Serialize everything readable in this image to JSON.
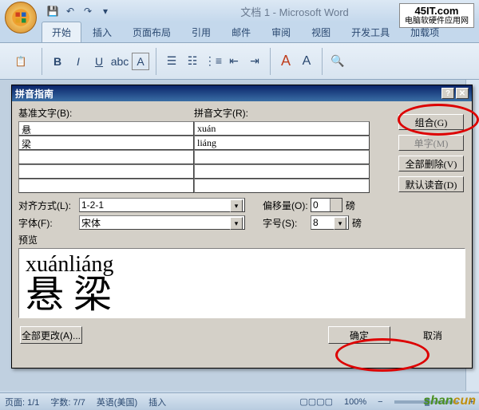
{
  "title": "文档 1 - Microsoft Word",
  "site_logo": {
    "main": "45IT.com",
    "sub": "电脑软硬件应用网"
  },
  "ribbon_tabs": [
    "开始",
    "插入",
    "页面布局",
    "引用",
    "邮件",
    "审阅",
    "视图",
    "开发工具",
    "加载项"
  ],
  "dialog": {
    "title": "拼音指南",
    "base_label": "基准文字(B):",
    "pinyin_label": "拼音文字(R):",
    "rows": [
      {
        "base": "悬",
        "pinyin": "xuán"
      },
      {
        "base": "梁",
        "pinyin": "liáng"
      },
      {
        "base": "",
        "pinyin": ""
      },
      {
        "base": "",
        "pinyin": ""
      },
      {
        "base": "",
        "pinyin": ""
      }
    ],
    "buttons": {
      "combine": "组合(G)",
      "single": "单字(M)",
      "clear_all": "全部删除(V)",
      "default_read": "默认读音(D)"
    },
    "align_label": "对齐方式(L):",
    "align_value": "1-2-1",
    "offset_label": "偏移量(O):",
    "offset_value": "0",
    "offset_unit": "磅",
    "font_label": "字体(F):",
    "font_value": "宋体",
    "size_label": "字号(S):",
    "size_value": "8",
    "size_unit": "磅",
    "preview_label": "预览",
    "preview_pinyin": "xuánliáng",
    "preview_hanzi": "悬 梁",
    "change_all": "全部更改(A)...",
    "ok": "确定",
    "cancel": "取消"
  },
  "status": {
    "page": "页面: 1/1",
    "words": "字数: 7/7",
    "lang": "英语(美国)",
    "mode": "插入",
    "zoom": "100%"
  },
  "watermark": "shancun"
}
